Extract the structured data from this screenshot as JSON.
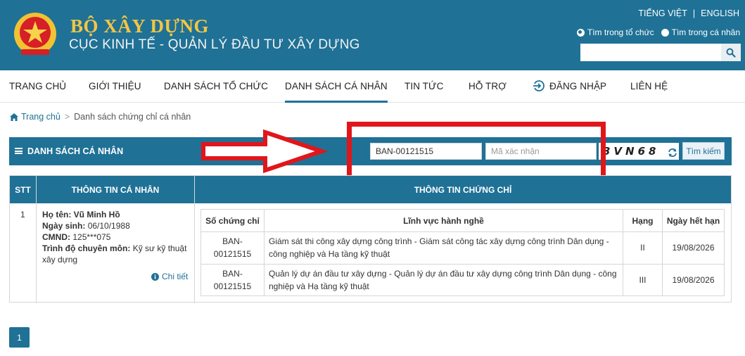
{
  "header": {
    "title": "BỘ XÂY DỰNG",
    "subtitle": "CỤC KINH TẾ - QUẢN LÝ ĐẦU TƯ XÂY DỰNG",
    "lang_vi": "TIẾNG VIỆT",
    "lang_sep": "|",
    "lang_en": "ENGLISH",
    "radio_org": "Tìm trong tổ chức",
    "radio_person": "Tìm trong cá nhân",
    "search_placeholder": ""
  },
  "nav": {
    "home": "TRANG CHỦ",
    "about": "GIỚI THIỆU",
    "orgs": "DANH SÁCH TỔ CHỨC",
    "persons": "DANH SÁCH CÁ NHÂN",
    "news": "TIN TỨC",
    "support": "HỖ TRỢ",
    "login": "ĐĂNG NHẬP",
    "contact": "LIÊN HỆ"
  },
  "breadcrumb": {
    "home": "Trang chủ",
    "sep": ">",
    "current": "Danh sách chứng chỉ cá nhân"
  },
  "section": {
    "title": "DANH SÁCH CÁ NHÂN",
    "cert_value": "BAN-00121515",
    "captcha_placeholder": "Mã xác nhận",
    "captcha_text": "3VN68",
    "search_button": "Tìm kiếm"
  },
  "table": {
    "headers": [
      "STT",
      "THÔNG TIN CÁ NHÂN",
      "THÔNG TIN CHỨNG CHỈ"
    ],
    "row": {
      "stt": "1",
      "name_label": "Họ tên:",
      "name": "Vũ Minh Hồ",
      "dob_label": "Ngày sinh:",
      "dob": "06/10/1988",
      "id_label": "CMND:",
      "id": "125***075",
      "level_label": "Trình độ chuyên môn:",
      "level_1": "Kỹ sư kỹ thuật",
      "level_2": "xây dựng",
      "detail": "Chi tiết"
    },
    "inner_headers": [
      "Số chứng chỉ",
      "Lĩnh vực hành nghề",
      "Hạng",
      "Ngày hết hạn"
    ],
    "certs": [
      {
        "no_1": "BAN-",
        "no_2": "00121515",
        "field_1": "Giám sát thi công xây dựng công trình - Giám sát công tác xây dựng công trình Dân dụng -",
        "field_2": "công nghiệp và Hạ tầng kỹ thuật",
        "grade": "II",
        "expiry": "19/08/2026"
      },
      {
        "no_1": "BAN-",
        "no_2": "00121515",
        "field_1": "Quản lý dự án đầu tư xây dựng - Quản lý dự án đầu tư xây dựng công trình Dân dụng - công",
        "field_2": "nghiệp và Hạ tầng kỹ thuật",
        "grade": "III",
        "expiry": "19/08/2026"
      }
    ]
  },
  "pagination": {
    "current": "1"
  },
  "colors": {
    "primary": "#1f7196",
    "accent_gold": "#f4c542",
    "annotation_red": "#e0161b"
  }
}
